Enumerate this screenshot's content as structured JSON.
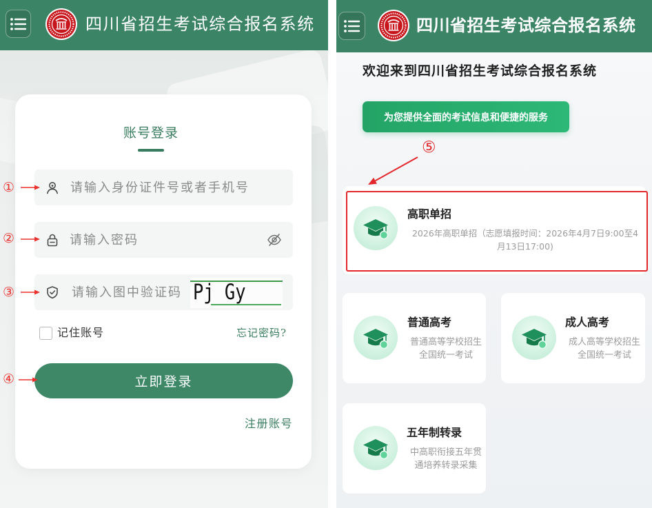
{
  "left_screen": {
    "header": {
      "title": "四川省招生考试综合报名系统",
      "menu_icon": "menu-icon",
      "logo_icon": "logo-seal-icon"
    },
    "login_card": {
      "title": "账号登录",
      "account_field": {
        "icon": "user-icon",
        "placeholder": "请输入身份证件号或者手机号",
        "value": ""
      },
      "password_field": {
        "icon": "lock-icon",
        "placeholder": "请输入密码",
        "value": "",
        "toggle_icon": "eye-off-icon"
      },
      "captcha_field": {
        "icon": "shield-check-icon",
        "placeholder": "请输入图中验证码",
        "value": "",
        "captcha_text": "Pj Gy"
      },
      "remember": {
        "label": "记住账号",
        "checked": false
      },
      "forgot_password": "忘记密码?",
      "login_button": "立即登录",
      "register_link": "注册账号"
    },
    "annotations": {
      "step_1": "①",
      "step_2": "②",
      "step_3": "③",
      "step_4": "④"
    }
  },
  "right_screen": {
    "header": {
      "title": "四川省招生考试综合报名系统",
      "menu_icon": "menu-icon",
      "logo_icon": "logo-seal-icon"
    },
    "welcome_heading": "欢迎来到四川省招生考试综合报名系统",
    "service_button": "为您提供全面的考试信息和便捷的服务",
    "annotations": {
      "step_5": "⑤"
    },
    "exam_cards": [
      {
        "title": "高职单招",
        "icon": "graduation-cap-icon",
        "highlighted": true,
        "desc_lines": [
          "2026年高职单招（志愿填报时间：2026年4月7日9:00至4",
          "月13日17:00)"
        ]
      },
      {
        "title": "普通高考",
        "icon": "graduation-cap-icon",
        "highlighted": false,
        "desc_lines": [
          "普通高等学校招生",
          "全国统一考试"
        ]
      },
      {
        "title": "成人高考",
        "icon": "graduation-cap-icon",
        "highlighted": false,
        "desc_lines": [
          "成人高等学校招生",
          "全国统一考试"
        ]
      },
      {
        "title": "五年制转录",
        "icon": "graduation-cap-icon",
        "highlighted": false,
        "desc_lines": [
          "中高职衔接五年贯",
          "通培养转录采集"
        ]
      }
    ]
  },
  "colors": {
    "header_green": "#3b8466",
    "accent_green": "#3a7c5f",
    "login_button_green": "#3e8868",
    "service_button_green": "#27aa6b",
    "annotation_red": "#e3262b",
    "card_icon_green": "#1f8f5c"
  }
}
